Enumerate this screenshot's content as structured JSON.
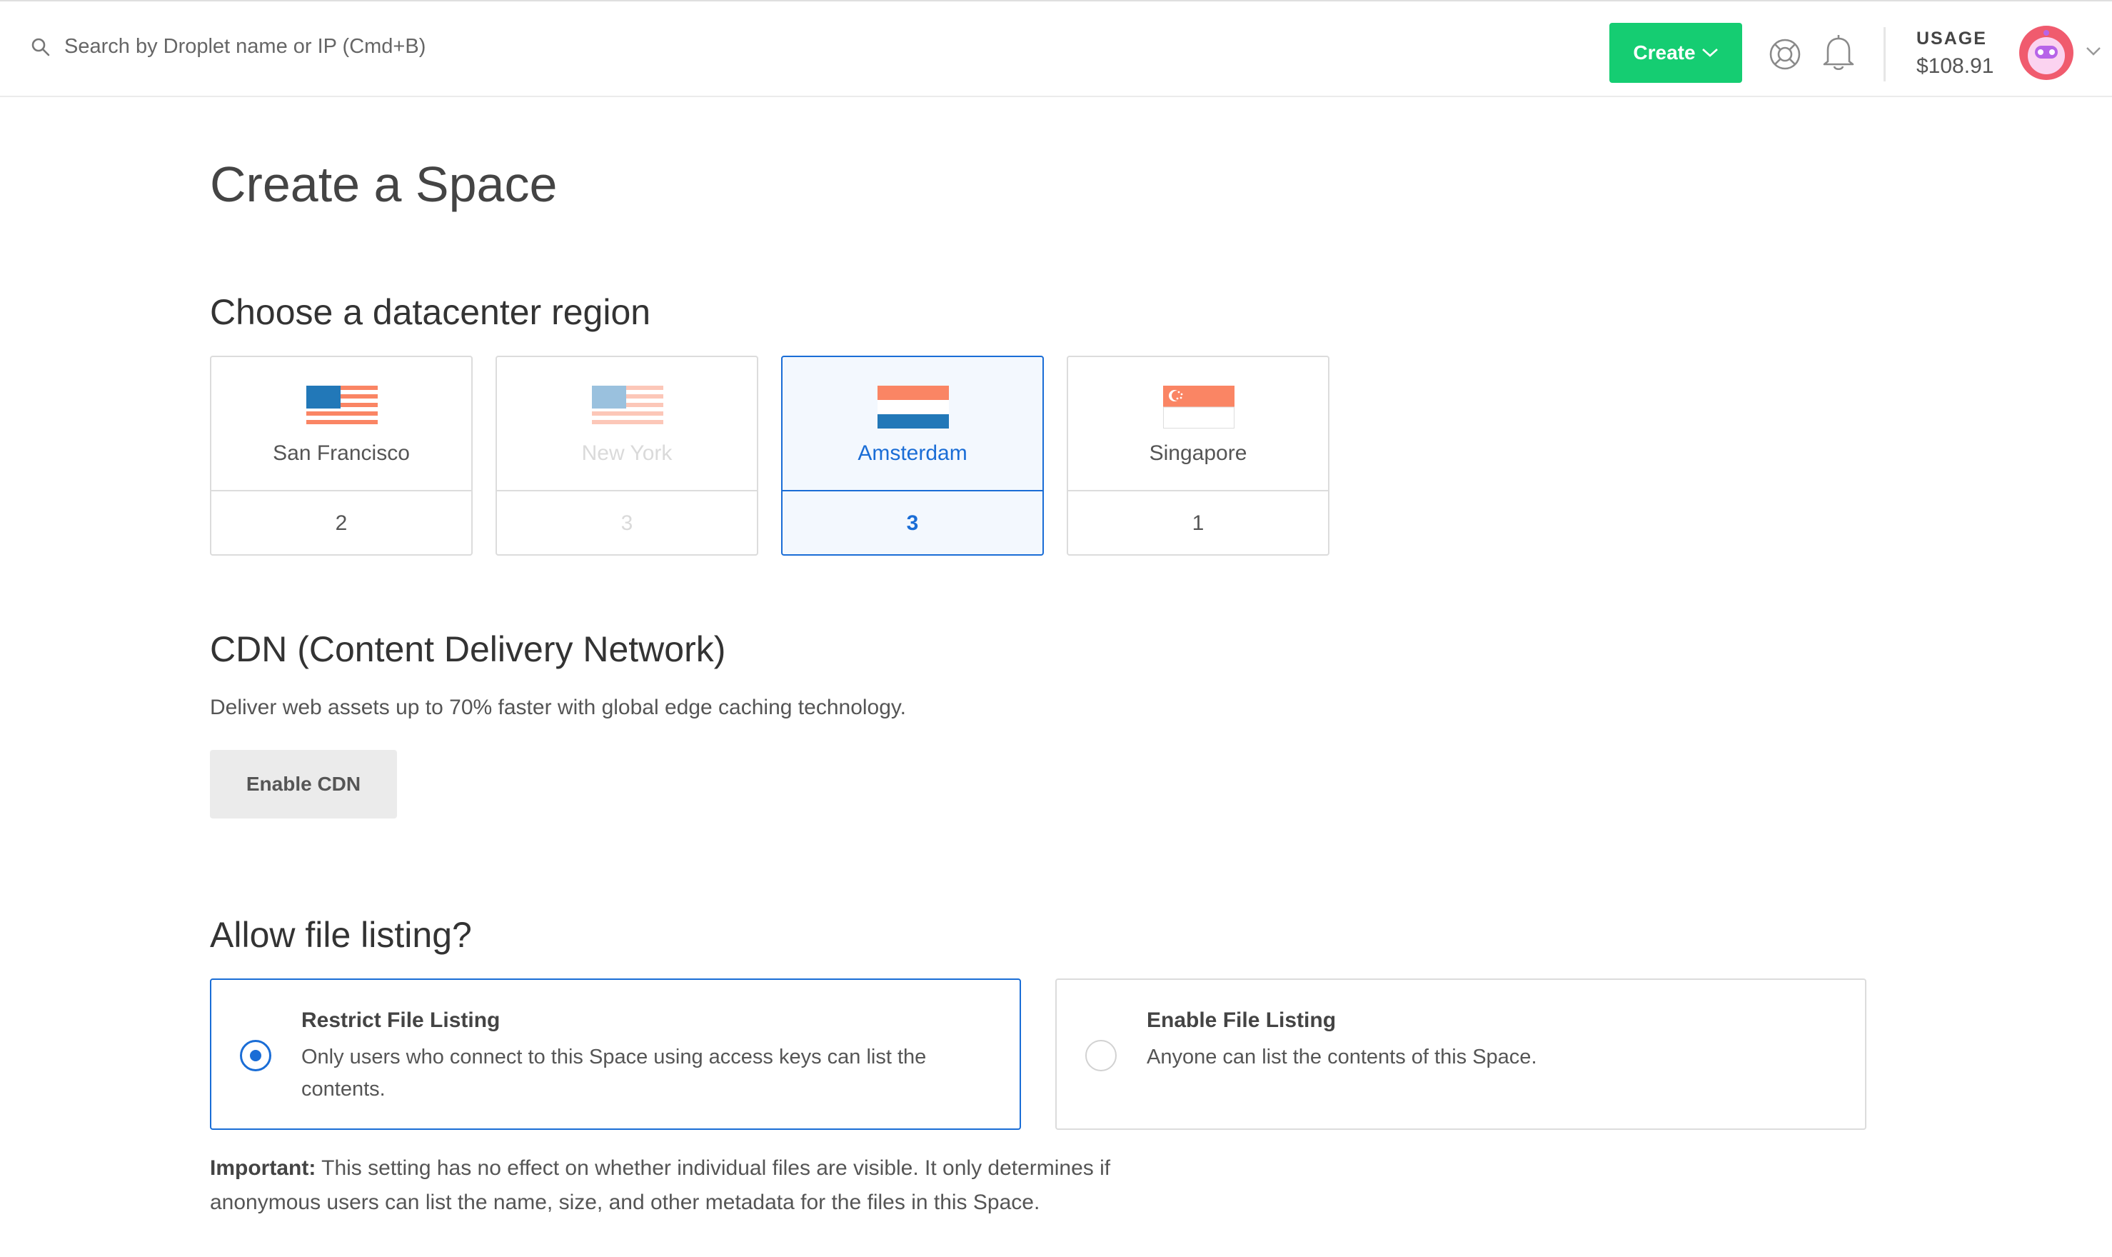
{
  "header": {
    "search_placeholder": "Search by Droplet name or IP (Cmd+B)",
    "create_label": "Create",
    "usage_label": "USAGE",
    "usage_value": "$108.91",
    "icons": [
      "search-icon",
      "help-lifebuoy-icon",
      "bell-icon",
      "chevron-down-icon",
      "avatar"
    ]
  },
  "page": {
    "title": "Create a Space"
  },
  "regions": {
    "heading": "Choose a datacenter region",
    "items": [
      {
        "name": "San Francisco",
        "count": "2",
        "state": "normal",
        "flag": "us"
      },
      {
        "name": "New York",
        "count": "3",
        "state": "disabled",
        "flag": "us"
      },
      {
        "name": "Amsterdam",
        "count": "3",
        "state": "selected",
        "flag": "nl"
      },
      {
        "name": "Singapore",
        "count": "1",
        "state": "normal",
        "flag": "sg"
      }
    ]
  },
  "cdn": {
    "heading": "CDN (Content Delivery Network)",
    "description": "Deliver web assets up to 70% faster with global edge caching technology.",
    "button_label": "Enable CDN"
  },
  "listing": {
    "heading": "Allow file listing?",
    "options": [
      {
        "title": "Restrict File Listing",
        "description": "Only users who connect to this Space using access keys can list the contents.",
        "selected": true
      },
      {
        "title": "Enable File Listing",
        "description": "Anyone can list the contents of this Space.",
        "selected": false
      }
    ],
    "note_label": "Important:",
    "note_text": " This setting has no effect on whether individual files are visible. It only determines if anonymous users can list the name, size, and other metadata for the files in this Space."
  },
  "colors": {
    "accent": "#1a6dd6",
    "create_green": "#15cd72",
    "flag_red": "#fa8564",
    "flag_blue": "#2278b8"
  }
}
